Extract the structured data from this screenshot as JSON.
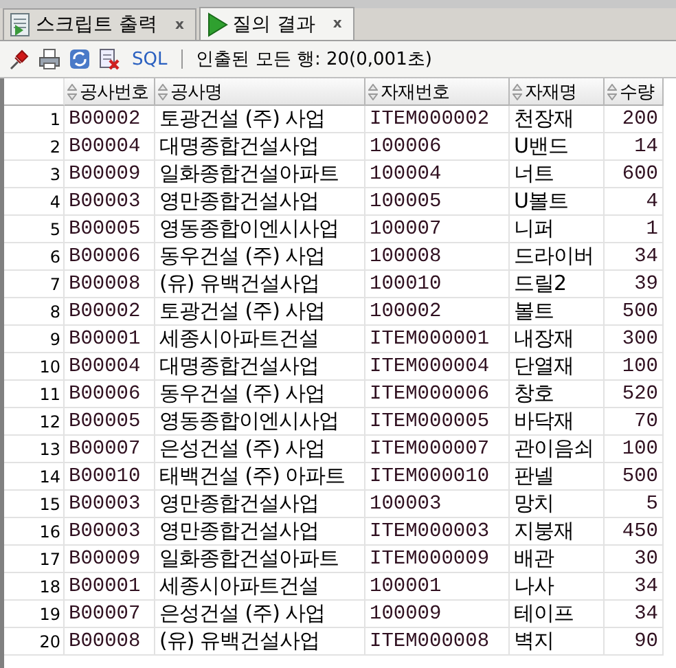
{
  "tabs": [
    {
      "label": "스크립트 출력",
      "kind": "script",
      "selected": false,
      "close": "x"
    },
    {
      "label": "질의 결과",
      "kind": "result",
      "selected": true,
      "close": "x"
    }
  ],
  "toolbar": {
    "sql_link": "SQL",
    "status": "인출된 모든 행: 20(0,001초)"
  },
  "table": {
    "columns": [
      "",
      "공사번호",
      "공사명",
      "자재번호",
      "자재명",
      "수량"
    ],
    "rows": [
      [
        "1",
        "B00002",
        "토광건설 (주) 사업",
        "ITEM000002",
        "천장재",
        "200"
      ],
      [
        "2",
        "B00004",
        "대명종합건설사업",
        "100006",
        "U밴드",
        "14"
      ],
      [
        "3",
        "B00009",
        "일화종합건설아파트",
        "100004",
        "너트",
        "600"
      ],
      [
        "4",
        "B00003",
        "영만종합건설사업",
        "100005",
        "U볼트",
        "4"
      ],
      [
        "5",
        "B00005",
        "영동종합이엔시사업",
        "100007",
        "니퍼",
        "1"
      ],
      [
        "6",
        "B00006",
        "동우건설 (주) 사업",
        "100008",
        "드라이버",
        "34"
      ],
      [
        "7",
        "B00008",
        "(유) 유백건설사업",
        "100010",
        "드릴2",
        "39"
      ],
      [
        "8",
        "B00002",
        "토광건설 (주) 사업",
        "100002",
        "볼트",
        "500"
      ],
      [
        "9",
        "B00001",
        "세종시아파트건설",
        "ITEM000001",
        "내장재",
        "300"
      ],
      [
        "10",
        "B00004",
        "대명종합건설사업",
        "ITEM000004",
        "단열재",
        "100"
      ],
      [
        "11",
        "B00006",
        "동우건설 (주) 사업",
        "ITEM000006",
        "창호",
        "520"
      ],
      [
        "12",
        "B00005",
        "영동종합이엔시사업",
        "ITEM000005",
        "바닥재",
        "70"
      ],
      [
        "13",
        "B00007",
        "은성건설 (주) 사업",
        "ITEM000007",
        "관이음쇠",
        "100"
      ],
      [
        "14",
        "B00010",
        "태백건설 (주) 아파트",
        "ITEM000010",
        "판넬",
        "500"
      ],
      [
        "15",
        "B00003",
        "영만종합건설사업",
        "100003",
        "망치",
        "5"
      ],
      [
        "16",
        "B00003",
        "영만종합건설사업",
        "ITEM000003",
        "지붕재",
        "450"
      ],
      [
        "17",
        "B00009",
        "일화종합건설아파트",
        "ITEM000009",
        "배관",
        "30"
      ],
      [
        "18",
        "B00001",
        "세종시아파트건설",
        "100001",
        "나사",
        "34"
      ],
      [
        "19",
        "B00007",
        "은성건설 (주) 사업",
        "100009",
        "테이프",
        "34"
      ],
      [
        "20",
        "B00008",
        "(유) 유백건설사업",
        "ITEM000008",
        "벽지",
        "90"
      ]
    ]
  }
}
